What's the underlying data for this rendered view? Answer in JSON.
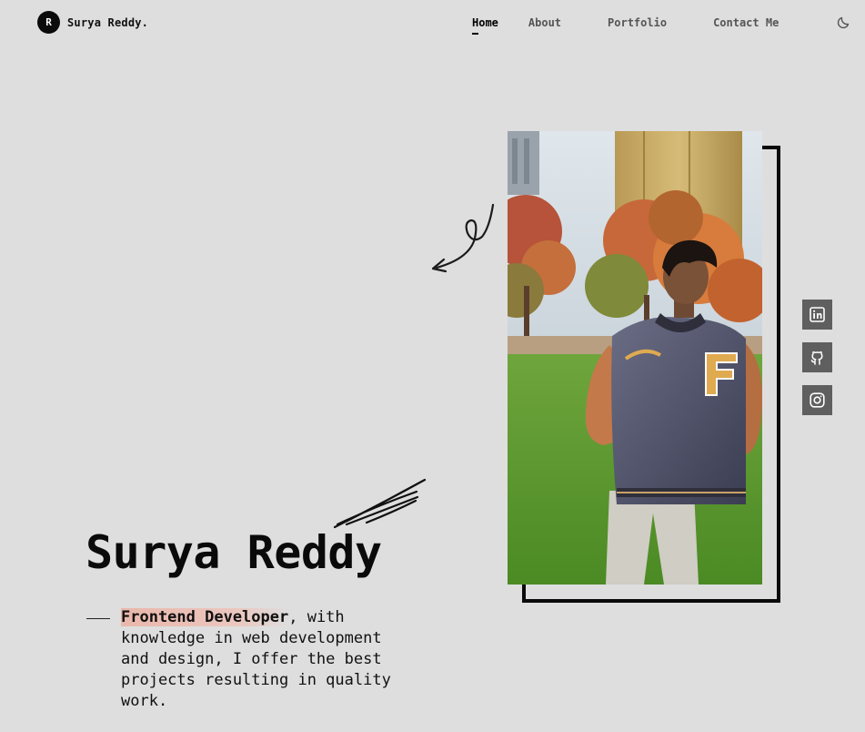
{
  "header": {
    "logo_letter": "R",
    "brand_name": "Surya Reddy."
  },
  "nav": {
    "items": [
      {
        "label": "Home",
        "active": true
      },
      {
        "label": "About",
        "active": false
      },
      {
        "label": "Portfolio",
        "active": false
      },
      {
        "label": "Contact Me",
        "active": false
      }
    ],
    "theme_toggle_icon": "moon-icon"
  },
  "hero": {
    "name": "Surya Reddy",
    "intro_role": "Frontend Developer",
    "intro_rest": ", with knowledge in web development and design, I offer the best projects resulting in quality work."
  },
  "social": [
    {
      "icon": "linkedin-icon"
    },
    {
      "icon": "github-icon"
    },
    {
      "icon": "instagram-icon"
    }
  ],
  "colors": {
    "background": "#dedede",
    "accent_highlight": "#e9b7ab",
    "social_button": "#5f5f5f",
    "text": "#111111"
  }
}
